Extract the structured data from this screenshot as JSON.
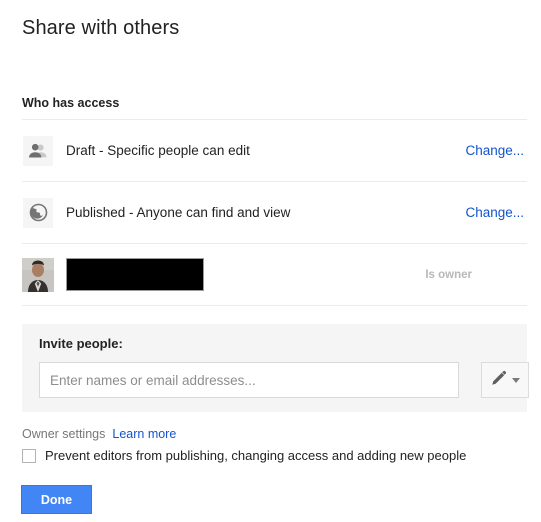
{
  "dialog": {
    "title": "Share with others",
    "section_label": "Who has access"
  },
  "access_rows": [
    {
      "icon": "people-icon",
      "label": "Draft - Specific people can edit",
      "action": "Change..."
    },
    {
      "icon": "globe-icon",
      "label": "Published - Anyone can find and view",
      "action": "Change..."
    },
    {
      "icon": "avatar-photo",
      "label": "",
      "action": "Is owner"
    }
  ],
  "invite": {
    "label": "Invite people:",
    "placeholder": "Enter names or email addresses...",
    "value": "",
    "permission_icon": "pencil-icon"
  },
  "owner_settings": {
    "label": "Owner settings",
    "learn_more": "Learn more",
    "prevent_label": "Prevent editors from publishing, changing access and adding new people",
    "prevent_checked": false
  },
  "footer": {
    "done_label": "Done"
  },
  "colors": {
    "link": "#1155cc",
    "primary_button": "#4285f4",
    "panel_bg": "#f5f5f5",
    "muted_text": "#b8b8b8"
  }
}
